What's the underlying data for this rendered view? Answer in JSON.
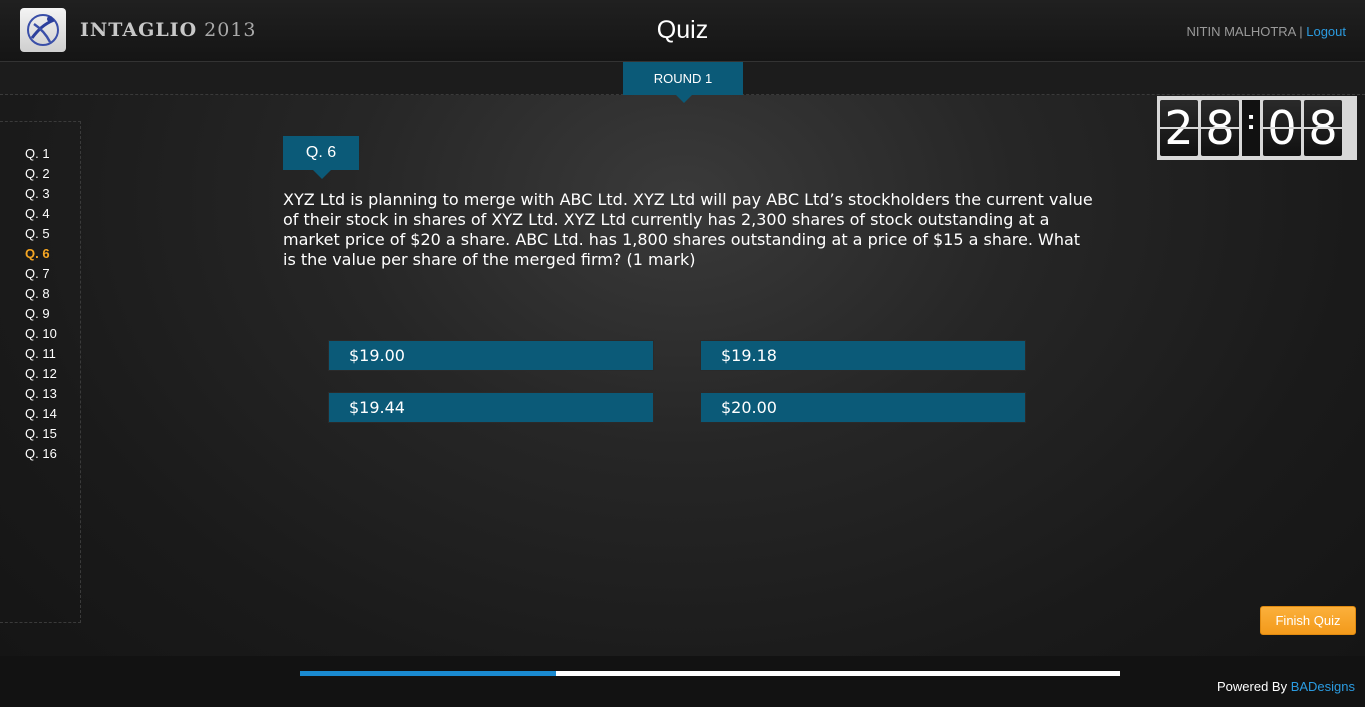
{
  "header": {
    "brand_bold": "INTAGLIO",
    "brand_year": "2013",
    "title": "Quiz",
    "user_name": "NITIN MALHOTRA",
    "separator": " | ",
    "logout_label": "Logout"
  },
  "round": {
    "label": "ROUND 1"
  },
  "sidebar": {
    "items": [
      {
        "label": "Q. 1"
      },
      {
        "label": "Q. 2"
      },
      {
        "label": "Q. 3"
      },
      {
        "label": "Q. 4"
      },
      {
        "label": "Q. 5"
      },
      {
        "label": "Q. 6"
      },
      {
        "label": "Q. 7"
      },
      {
        "label": "Q. 8"
      },
      {
        "label": "Q. 9"
      },
      {
        "label": "Q. 10"
      },
      {
        "label": "Q. 11"
      },
      {
        "label": "Q. 12"
      },
      {
        "label": "Q. 13"
      },
      {
        "label": "Q. 14"
      },
      {
        "label": "Q. 15"
      },
      {
        "label": "Q. 16"
      }
    ],
    "active_index": 5
  },
  "timer": {
    "d1": "2",
    "d2": "8",
    "colon": ":",
    "d3": "0",
    "d4": "8"
  },
  "question": {
    "badge": "Q. 6",
    "text": "XYZ Ltd is planning to merge with ABC Ltd. XYZ Ltd will pay ABC Ltd’s stockholders the current value of their stock in shares of XYZ Ltd. XYZ Ltd currently has 2,300 shares of stock outstanding at a market price of $20 a share. ABC Ltd. has 1,800 shares outstanding at a price of $15 a share. What is the value per share of the merged firm? (1 mark)",
    "options": [
      {
        "label": "$19.00"
      },
      {
        "label": "$19.18"
      },
      {
        "label": "$19.44"
      },
      {
        "label": "$20.00"
      }
    ]
  },
  "actions": {
    "finish_label": "Finish Quiz"
  },
  "footer": {
    "progress_fraction": 0.3125,
    "powered_prefix": "Powered By ",
    "powered_brand": "BADesigns"
  },
  "colors": {
    "accent_teal": "#0b5a78",
    "active_orange": "#f5a623",
    "link_blue": "#2b9be0",
    "progress_blue": "#1a8ad0",
    "finish_orange": "#f7a52a"
  }
}
